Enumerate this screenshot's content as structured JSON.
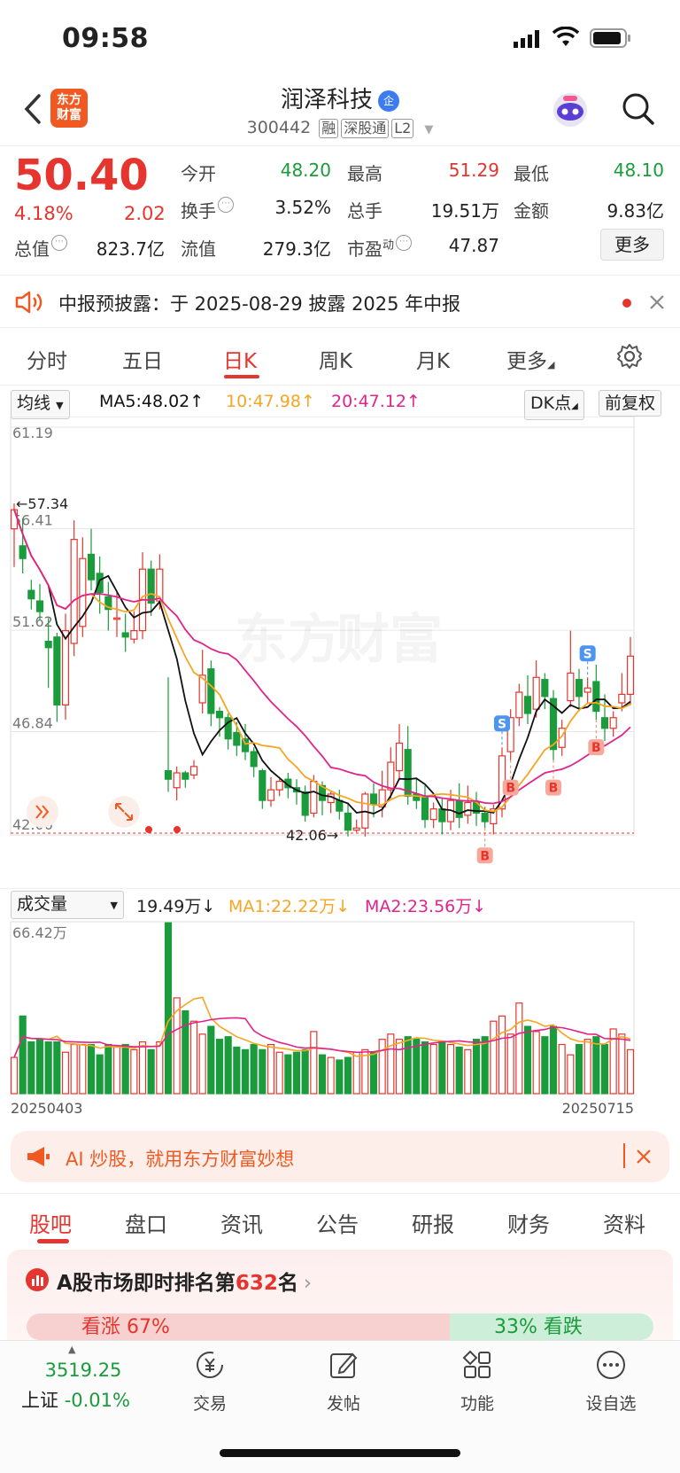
{
  "status": {
    "time": "09:58"
  },
  "header": {
    "logo_line1": "东方",
    "logo_line2": "财富",
    "name": "润泽科技",
    "enterprise_badge": "企",
    "code": "300442",
    "tags": [
      "融",
      "深股通",
      "L2"
    ]
  },
  "quote": {
    "price": "50.40",
    "change_pct": "4.18%",
    "change": "2.02",
    "rows": [
      [
        {
          "label": "今开",
          "value": "48.20",
          "color": "green"
        },
        {
          "label": "最高",
          "value": "51.29",
          "color": "red"
        },
        {
          "label": "最低",
          "value": "48.10",
          "color": "green"
        }
      ],
      [
        {
          "label": "换手",
          "value": "3.52%",
          "color": "dark"
        },
        {
          "label": "总手",
          "value": "19.51万",
          "color": "dark"
        },
        {
          "label": "金额",
          "value": "9.83亿",
          "color": "dark"
        }
      ],
      [
        {
          "label": "总值",
          "value": "823.7亿",
          "color": "dark"
        },
        {
          "label": "流值",
          "value": "279.3亿",
          "color": "dark"
        },
        {
          "label": "市盈",
          "label_sup": "动",
          "value": "47.87",
          "color": "dark"
        }
      ]
    ],
    "more_label": "更多"
  },
  "notice": {
    "text": "中报预披露：于 2025-08-29 披露 2025 年中报"
  },
  "kline_tabs": [
    "分时",
    "五日",
    "日K",
    "周K",
    "月K",
    "更多"
  ],
  "kline_active": "日K",
  "ma_bar": {
    "selector": "均线",
    "ma5": "MA5:48.02↑",
    "ma10": "10:47.98↑",
    "ma20": "20:47.12↑",
    "dk": "DK点",
    "adjust": "前复权",
    "colors": {
      "ma5": "#111111",
      "ma10": "#f5a623",
      "ma20": "#e0248a"
    }
  },
  "chart_data": {
    "type": "candlestick",
    "y_ticks": [
      "61.19",
      "56.41",
      "51.62",
      "46.84",
      "42.06"
    ],
    "ylim": [
      42.06,
      61.19
    ],
    "high_marker": "←57.34",
    "low_marker": "42.06→",
    "signals": [
      "S",
      "S",
      "B",
      "B",
      "B",
      "B"
    ],
    "candles": [
      {
        "o": 56.4,
        "c": 57.3,
        "h": 57.6,
        "l": 54.6
      },
      {
        "o": 55.6,
        "c": 55.0,
        "h": 56.9,
        "l": 54.3
      },
      {
        "o": 53.5,
        "c": 53.1,
        "h": 54.0,
        "l": 52.6
      },
      {
        "o": 53.0,
        "c": 52.5,
        "h": 53.8,
        "l": 52.1
      },
      {
        "o": 51.1,
        "c": 50.8,
        "h": 52.2,
        "l": 48.9
      },
      {
        "o": 51.3,
        "c": 48.1,
        "h": 51.5,
        "l": 47.3
      },
      {
        "o": 48.1,
        "c": 51.6,
        "h": 52.4,
        "l": 47.4
      },
      {
        "o": 51.0,
        "c": 55.9,
        "h": 56.8,
        "l": 50.4
      },
      {
        "o": 51.8,
        "c": 55.0,
        "h": 56.0,
        "l": 51.3
      },
      {
        "o": 55.2,
        "c": 54.0,
        "h": 56.4,
        "l": 53.5
      },
      {
        "o": 54.3,
        "c": 53.4,
        "h": 55.1,
        "l": 52.4
      },
      {
        "o": 53.2,
        "c": 52.6,
        "h": 53.9,
        "l": 51.6
      },
      {
        "o": 52.2,
        "c": 52.2,
        "h": 53.4,
        "l": 51.3
      },
      {
        "o": 51.5,
        "c": 51.3,
        "h": 52.4,
        "l": 50.6
      },
      {
        "o": 51.2,
        "c": 51.6,
        "h": 52.5,
        "l": 51.0
      },
      {
        "o": 51.6,
        "c": 54.5,
        "h": 55.3,
        "l": 51.2
      },
      {
        "o": 54.5,
        "c": 52.9,
        "h": 54.9,
        "l": 52.3
      },
      {
        "o": 53.0,
        "c": 54.5,
        "h": 55.2,
        "l": 52.6
      },
      {
        "o": 45.0,
        "c": 44.6,
        "h": 49.4,
        "l": 44.0
      },
      {
        "o": 44.2,
        "c": 44.9,
        "h": 45.2,
        "l": 43.6
      },
      {
        "o": 44.9,
        "c": 44.6,
        "h": 45.0,
        "l": 44.2
      },
      {
        "o": 44.8,
        "c": 45.2,
        "h": 45.5,
        "l": 44.6
      },
      {
        "o": 48.2,
        "c": 49.5,
        "h": 50.7,
        "l": 47.7
      },
      {
        "o": 49.8,
        "c": 47.7,
        "h": 50.2,
        "l": 47.1
      },
      {
        "o": 47.8,
        "c": 47.5,
        "h": 48.0,
        "l": 46.6
      },
      {
        "o": 47.5,
        "c": 46.5,
        "h": 47.7,
        "l": 46.0
      },
      {
        "o": 46.8,
        "c": 46.2,
        "h": 47.3,
        "l": 45.7
      },
      {
        "o": 46.5,
        "c": 45.9,
        "h": 47.2,
        "l": 45.5
      },
      {
        "o": 45.9,
        "c": 45.2,
        "h": 46.1,
        "l": 44.7
      },
      {
        "o": 45.0,
        "c": 43.6,
        "h": 45.1,
        "l": 43.2
      },
      {
        "o": 43.6,
        "c": 44.1,
        "h": 44.7,
        "l": 43.3
      },
      {
        "o": 44.1,
        "c": 44.5,
        "h": 44.6,
        "l": 43.8
      },
      {
        "o": 44.6,
        "c": 44.2,
        "h": 44.9,
        "l": 43.7
      },
      {
        "o": 44.2,
        "c": 44.0,
        "h": 44.6,
        "l": 43.4
      },
      {
        "o": 44.0,
        "c": 42.9,
        "h": 44.3,
        "l": 42.6
      },
      {
        "o": 43.0,
        "c": 44.5,
        "h": 44.8,
        "l": 42.8
      },
      {
        "o": 44.3,
        "c": 43.6,
        "h": 44.5,
        "l": 42.9
      },
      {
        "o": 43.5,
        "c": 43.9,
        "h": 44.0,
        "l": 43.0
      },
      {
        "o": 43.6,
        "c": 43.1,
        "h": 44.1,
        "l": 42.7
      },
      {
        "o": 43.0,
        "c": 42.2,
        "h": 43.5,
        "l": 41.9
      },
      {
        "o": 42.2,
        "c": 42.3,
        "h": 42.7,
        "l": 42.1
      },
      {
        "o": 42.3,
        "c": 43.9,
        "h": 44.0,
        "l": 41.9
      },
      {
        "o": 43.9,
        "c": 43.4,
        "h": 44.4,
        "l": 42.8
      },
      {
        "o": 43.3,
        "c": 44.1,
        "h": 45.0,
        "l": 42.8
      },
      {
        "o": 44.1,
        "c": 45.4,
        "h": 46.1,
        "l": 43.7
      },
      {
        "o": 45.0,
        "c": 46.3,
        "h": 47.2,
        "l": 44.6
      },
      {
        "o": 46.0,
        "c": 43.8,
        "h": 47.1,
        "l": 43.4
      },
      {
        "o": 43.9,
        "c": 43.6,
        "h": 44.6,
        "l": 43.2
      },
      {
        "o": 43.8,
        "c": 42.7,
        "h": 44.3,
        "l": 42.3
      },
      {
        "o": 42.7,
        "c": 43.2,
        "h": 43.5,
        "l": 42.3
      },
      {
        "o": 43.2,
        "c": 42.6,
        "h": 43.7,
        "l": 42.0
      },
      {
        "o": 42.6,
        "c": 43.6,
        "h": 44.1,
        "l": 42.2
      },
      {
        "o": 43.6,
        "c": 42.8,
        "h": 44.4,
        "l": 42.3
      },
      {
        "o": 42.9,
        "c": 43.5,
        "h": 44.3,
        "l": 42.5
      },
      {
        "o": 43.5,
        "c": 43.0,
        "h": 44.0,
        "l": 42.4
      },
      {
        "o": 43.0,
        "c": 42.6,
        "h": 43.3,
        "l": 42.3
      },
      {
        "o": 42.5,
        "c": 43.2,
        "h": 43.4,
        "l": 42.0
      },
      {
        "o": 43.2,
        "c": 45.7,
        "h": 46.1,
        "l": 42.8
      },
      {
        "o": 45.9,
        "c": 47.5,
        "h": 47.9,
        "l": 45.5
      },
      {
        "o": 47.5,
        "c": 48.7,
        "h": 49.1,
        "l": 47.1
      },
      {
        "o": 48.5,
        "c": 47.7,
        "h": 49.5,
        "l": 47.2
      },
      {
        "o": 47.9,
        "c": 49.4,
        "h": 50.2,
        "l": 47.5
      },
      {
        "o": 49.3,
        "c": 48.5,
        "h": 49.6,
        "l": 47.9
      },
      {
        "o": 48.4,
        "c": 46.0,
        "h": 48.8,
        "l": 45.5
      },
      {
        "o": 46.1,
        "c": 47.0,
        "h": 47.4,
        "l": 45.7
      },
      {
        "o": 48.3,
        "c": 49.6,
        "h": 51.6,
        "l": 48.0
      },
      {
        "o": 49.3,
        "c": 48.5,
        "h": 49.8,
        "l": 47.8
      },
      {
        "o": 48.7,
        "c": 48.9,
        "h": 49.4,
        "l": 48.2
      },
      {
        "o": 49.2,
        "c": 47.8,
        "h": 50.0,
        "l": 47.4
      },
      {
        "o": 47.5,
        "c": 47.0,
        "h": 48.6,
        "l": 46.4
      },
      {
        "o": 47.0,
        "c": 47.5,
        "h": 47.8,
        "l": 46.6
      },
      {
        "o": 48.2,
        "c": 48.6,
        "h": 49.6,
        "l": 47.8
      },
      {
        "o": 48.6,
        "c": 50.4,
        "h": 51.3,
        "l": 48.1
      }
    ],
    "volume": {
      "label": "成交量",
      "vol": "19.49万↓",
      "ma1": "MA1:22.22万↓",
      "ma2": "MA2:23.56万↓",
      "max_tick": "66.42万",
      "values": [
        14,
        30,
        20,
        21,
        20,
        20,
        16,
        19,
        19,
        19,
        15,
        19,
        18,
        19,
        17,
        20,
        17,
        20,
        66,
        37,
        32,
        28,
        23,
        26,
        21,
        22,
        18,
        17,
        19,
        17,
        19,
        16,
        15,
        16,
        17,
        24,
        15,
        14,
        13,
        14,
        16,
        17,
        16,
        21,
        23,
        21,
        22,
        21,
        20,
        19,
        20,
        19,
        18,
        17,
        21,
        22,
        28,
        30,
        23,
        35,
        26,
        24,
        22,
        26,
        19,
        15,
        19,
        21,
        22,
        19,
        25,
        23,
        17,
        20
      ],
      "ylim": [
        0,
        66.42
      ]
    },
    "x_start": "20250403",
    "x_end": "20250715"
  },
  "ad_banner": {
    "text": "AI 炒股，就用东方财富妙想"
  },
  "info_tabs": [
    "股吧",
    "盘口",
    "资讯",
    "公告",
    "研报",
    "财务",
    "资料"
  ],
  "info_active": "股吧",
  "rank_text_prefix": "A股市场即时排名第",
  "rank_num": "632",
  "rank_suffix": "名",
  "sentiment": {
    "up": "看涨 67%",
    "down": "33% 看跌"
  },
  "bottom_nav": {
    "index_value": "3519.25",
    "index_name": "上证",
    "index_change": "-0.01%",
    "items": [
      "交易",
      "发帖",
      "功能",
      "设自选"
    ]
  }
}
